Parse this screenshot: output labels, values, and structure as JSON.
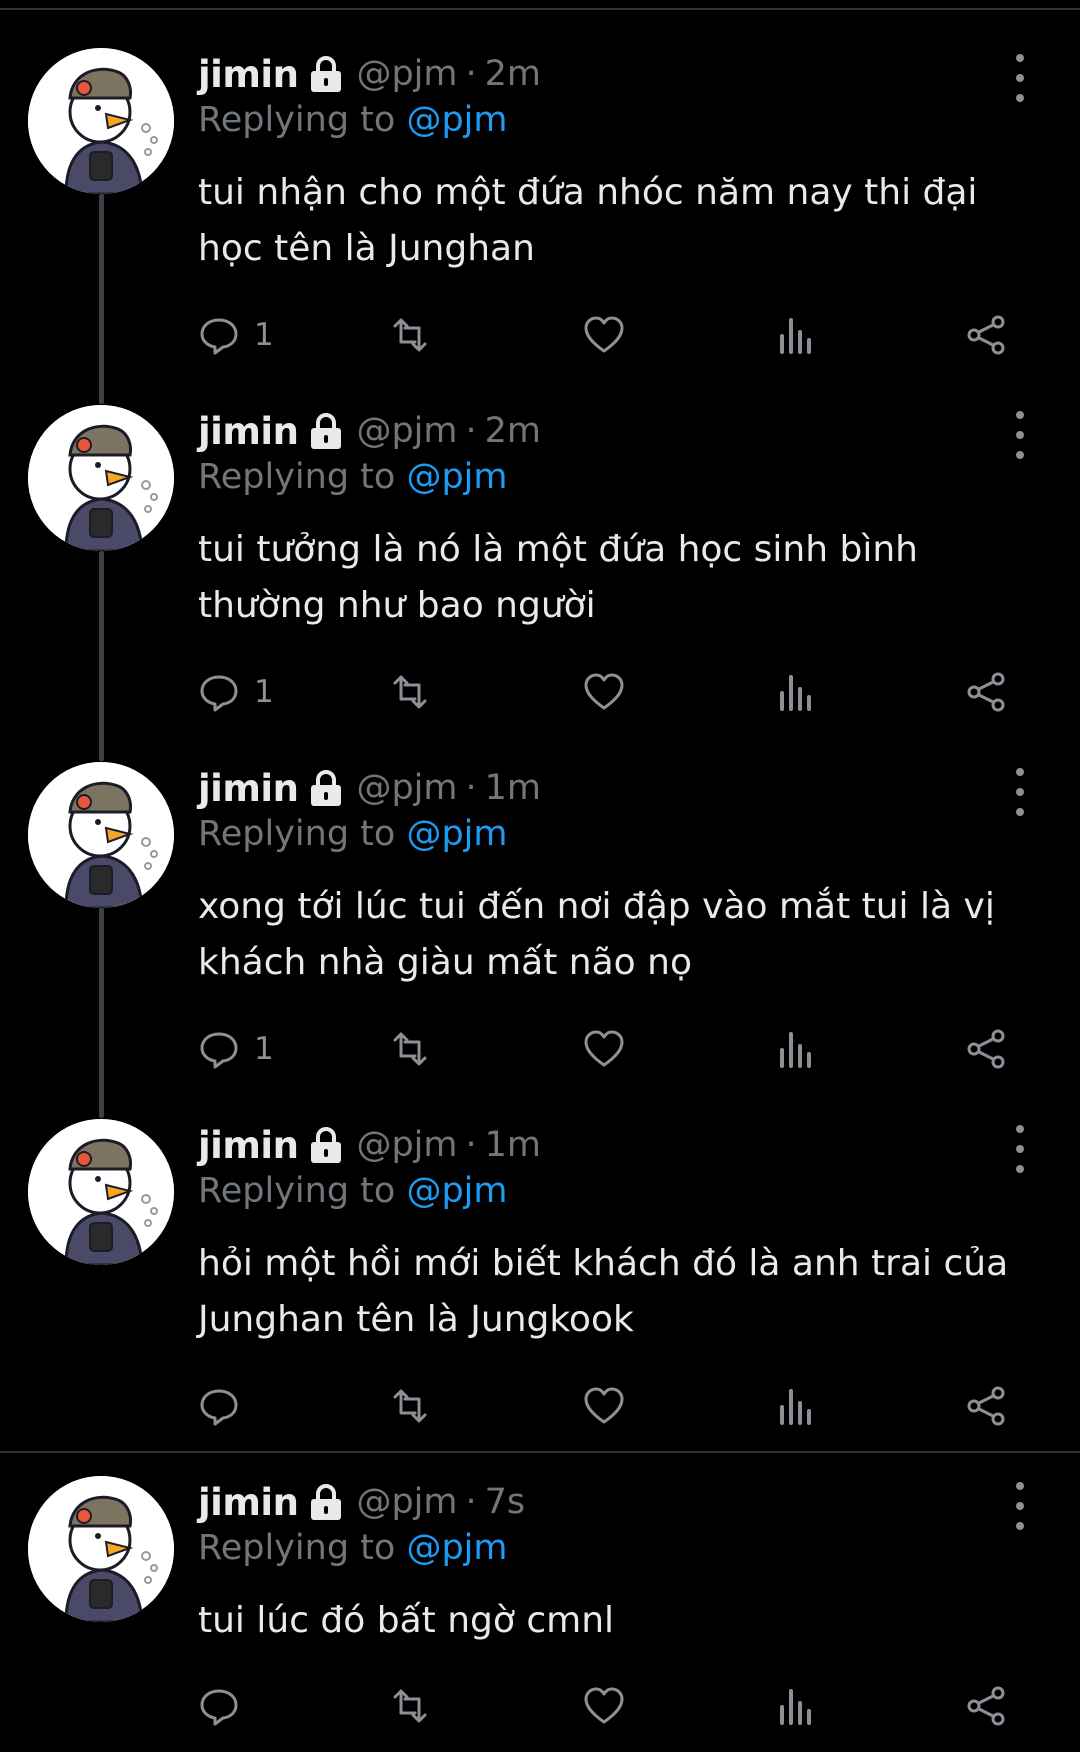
{
  "colors": {
    "background": "#000000",
    "text": "#e7e9ea",
    "secondary": "#71767b",
    "mention": "#1d9bf0",
    "thread_line": "#3e4144"
  },
  "tweets": [
    {
      "name": "jimin",
      "handle": "@pjm",
      "separator": "·",
      "time": "2m",
      "replying_prefix": "Replying to",
      "replying_to": "@pjm",
      "text": "tui nhận cho một đứa nhóc năm nay thi đại học tên là Junghan",
      "reply_count": "1",
      "icons": [
        "reply-icon",
        "retweet-icon",
        "like-icon",
        "analytics-icon",
        "share-icon"
      ]
    },
    {
      "name": "jimin",
      "handle": "@pjm",
      "separator": "·",
      "time": "2m",
      "replying_prefix": "Replying to",
      "replying_to": "@pjm",
      "text": "tui tưởng là nó là một đứa học sinh bình thường như bao người",
      "reply_count": "1",
      "icons": [
        "reply-icon",
        "retweet-icon",
        "like-icon",
        "analytics-icon",
        "share-icon"
      ]
    },
    {
      "name": "jimin",
      "handle": "@pjm",
      "separator": "·",
      "time": "1m",
      "replying_prefix": "Replying to",
      "replying_to": "@pjm",
      "text": "xong tới lúc tui đến nơi đập vào mắt tui là vị khách nhà giàu mất não nọ",
      "reply_count": "1",
      "icons": [
        "reply-icon",
        "retweet-icon",
        "like-icon",
        "analytics-icon",
        "share-icon"
      ]
    },
    {
      "name": "jimin",
      "handle": "@pjm",
      "separator": "·",
      "time": "1m",
      "replying_prefix": "Replying to",
      "replying_to": "@pjm",
      "text": "hỏi một hồi mới biết khách đó là anh trai của Junghan tên là Jungkook",
      "reply_count": "",
      "icons": [
        "reply-icon",
        "retweet-icon",
        "like-icon",
        "analytics-icon",
        "share-icon"
      ]
    },
    {
      "name": "jimin",
      "handle": "@pjm",
      "separator": "·",
      "time": "7s",
      "replying_prefix": "Replying to",
      "replying_to": "@pjm",
      "text": "tui lúc đó bất ngờ cmnl",
      "reply_count": "",
      "icons": [
        "reply-icon",
        "retweet-icon",
        "like-icon",
        "analytics-icon",
        "share-icon"
      ]
    }
  ]
}
